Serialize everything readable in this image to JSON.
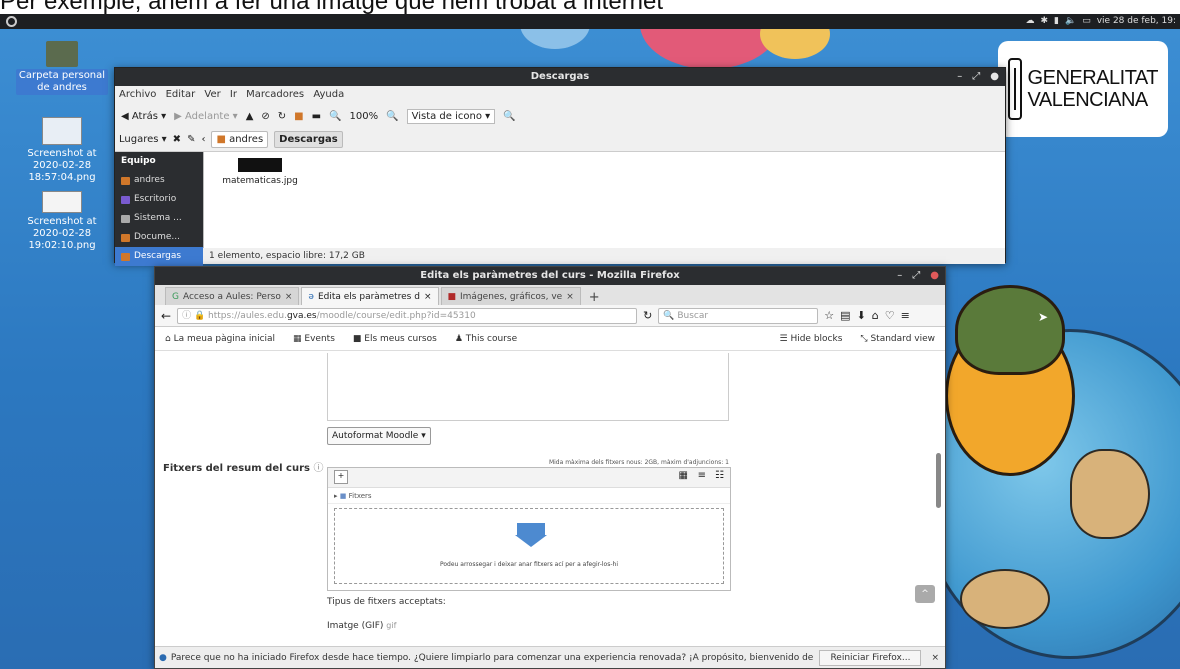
{
  "caption": "Per exemple, anem a fer una imatge que hem trobat a internet",
  "top_panel": {
    "datetime": "vie 28 de feb, 19:"
  },
  "desktop": {
    "icons": [
      {
        "label": "Carpeta personal de andres",
        "selected": true
      },
      {
        "label": "Screenshot at 2020-02-28 18:57:04.png",
        "selected": false
      },
      {
        "label": "Screenshot at 2020-02-28 19:02:10.png",
        "selected": false
      }
    ],
    "logo": {
      "line1": "GENERALITAT",
      "line2": "VALENCIANA"
    }
  },
  "filemanager": {
    "title": "Descargas",
    "menu": [
      "Archivo",
      "Editar",
      "Ver",
      "Ir",
      "Marcadores",
      "Ayuda"
    ],
    "toolbar": {
      "back": "Atrás",
      "forward": "Adelante",
      "zoom": "100%",
      "view": "Vista de icono"
    },
    "places_label": "Lugares",
    "breadcrumb": [
      "andres",
      "Descargas"
    ],
    "sidebar": {
      "header": "Equipo",
      "items": [
        "andres",
        "Escritorio",
        "Sistema ...",
        "Docume...",
        "Descargas"
      ]
    },
    "file": {
      "name": "matematicas.jpg"
    },
    "status": "1 elemento, espacio libre: 17,2 GB"
  },
  "firefox": {
    "title": "Edita els paràmetres del curs - Mozilla Firefox",
    "tabs": [
      "Acceso a Aules: Perso",
      "Edita els paràmetres d",
      "Imágenes, gráficos, ve"
    ],
    "url": {
      "prefix": "https://aules.edu.",
      "domain": "gva.es",
      "suffix": "/moodle/course/edit.php?id=45310"
    },
    "search_placeholder": "Buscar",
    "nav": {
      "home": "La meua pàgina inicial",
      "events": "Events",
      "mycourses": "Els meus cursos",
      "thiscourse": "This course",
      "hide": "Hide blocks",
      "standard": "Standard view"
    },
    "format_select": "Autoformat Moodle",
    "files_label": "Fitxers del resum del curs",
    "max_size": "Mida màxima dels fitxers nous: 2GB, màxim d'adjuncions: 1",
    "folder": "Fitxers",
    "drop_hint": "Podeu arrossegar i deixar anar fitxers ací per a afegir-los-hi",
    "accepted": "Tipus de fitxers acceptats:",
    "gif_label": "Imatge (GIF)",
    "gif_ext": "gif",
    "notification": "Parece que no ha iniciado Firefox desde hace tiempo. ¿Quiere limpiarlo para comenzar una experiencia renovada? ¡A propósito, bienvenido de nuevo!",
    "refresh_button": "Reiniciar Firefox..."
  },
  "colors": {
    "accent": "#3d7ad0",
    "panel": "#1d1f22",
    "titlebar": "#2b2d30",
    "drop_arrow": "#4d8ad0"
  }
}
